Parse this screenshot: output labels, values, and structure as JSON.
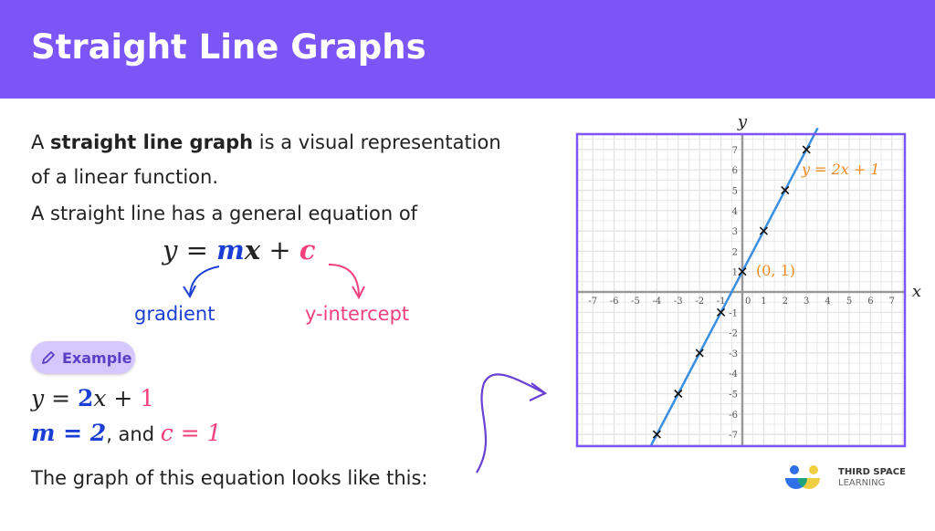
{
  "header": {
    "title": "Straight Line Graphs"
  },
  "intro": {
    "line1_pre": "A ",
    "line1_bold": "straight line graph",
    "line1_post": " is a visual representation",
    "line2": "of a linear function.",
    "line3": "A straight line has a general equation of"
  },
  "general_equation": {
    "y": "y",
    "equals": " = ",
    "m": "m",
    "x": "x",
    "plus": " + ",
    "c": "c"
  },
  "labels": {
    "gradient": "gradient",
    "y_intercept": "y-intercept"
  },
  "example_badge": {
    "label": "Example",
    "icon": "pencil-icon"
  },
  "example": {
    "eq_y": "y",
    "eq_equals": " = ",
    "eq_m": "2",
    "eq_x": "x",
    "eq_plus": " + ",
    "eq_c": "1",
    "m_part": "m = 2",
    "and": ", and ",
    "c_part": "c = 1"
  },
  "conclusion": "The graph of this equation looks like this:",
  "logo": {
    "line1": "THIRD SPACE",
    "line2": "LEARNING"
  },
  "colors": {
    "header": "#7b55f6",
    "gradient": "#1b3fd4",
    "intercept": "#f2407a",
    "line": "#3a8fe0",
    "annotation": "#f08a1e",
    "frame": "#7b55f6"
  },
  "chart_data": {
    "type": "line",
    "xlabel": "x",
    "ylabel": "y",
    "xlim": [
      -7,
      7
    ],
    "ylim": [
      -7,
      7
    ],
    "x_ticks": [
      -7,
      -6,
      -5,
      -4,
      -3,
      -2,
      -1,
      1,
      2,
      3,
      4,
      5,
      6,
      7
    ],
    "y_ticks": [
      -7,
      -6,
      -5,
      -4,
      -3,
      -2,
      -1,
      1,
      2,
      3,
      4,
      5,
      6,
      7
    ],
    "origin_label": "0",
    "grid": true,
    "series": [
      {
        "name": "y = 2x + 1",
        "slope": 2,
        "intercept": 1
      }
    ],
    "points": [
      {
        "x": -4,
        "y": -7
      },
      {
        "x": -3,
        "y": -5
      },
      {
        "x": -2,
        "y": -3
      },
      {
        "x": -1,
        "y": -1
      },
      {
        "x": 0,
        "y": 1
      },
      {
        "x": 1,
        "y": 3
      },
      {
        "x": 2,
        "y": 5
      },
      {
        "x": 3,
        "y": 7
      }
    ],
    "annotations": [
      {
        "text": "y = 2x + 1"
      },
      {
        "text": "(0, 1)"
      }
    ]
  }
}
